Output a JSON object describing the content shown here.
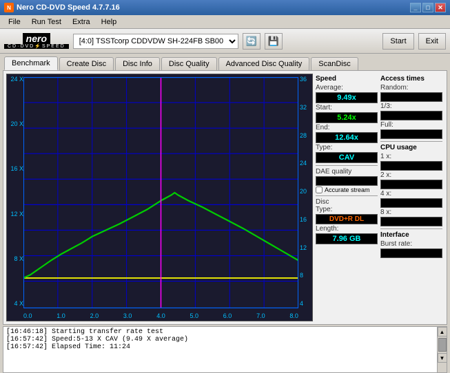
{
  "window": {
    "title": "Nero CD-DVD Speed 4.7.7.16"
  },
  "menu": {
    "items": [
      "File",
      "Run Test",
      "Extra",
      "Help"
    ]
  },
  "toolbar": {
    "drive_value": "[4:0]  TSSTcorp CDDVDW SH-224FB SB00",
    "start_label": "Start",
    "exit_label": "Exit"
  },
  "tabs": [
    {
      "label": "Benchmark",
      "active": true
    },
    {
      "label": "Create Disc",
      "active": false
    },
    {
      "label": "Disc Info",
      "active": false
    },
    {
      "label": "Disc Quality",
      "active": false
    },
    {
      "label": "Advanced Disc Quality",
      "active": false
    },
    {
      "label": "ScanDisc",
      "active": false
    }
  ],
  "speed_panel": {
    "header": "Speed",
    "average_label": "Average:",
    "average_value": "9.49x",
    "start_label": "Start:",
    "start_value": "5.24x",
    "end_label": "End:",
    "end_value": "12.64x",
    "type_label": "Type:",
    "type_value": "CAV"
  },
  "dae_panel": {
    "header": "DAE quality",
    "value": "",
    "accurate_stream_label": "Accurate stream"
  },
  "disc_panel": {
    "header": "Disc",
    "type_label": "Type:",
    "type_value": "DVD+R DL",
    "length_label": "Length:",
    "length_value": "7.96 GB"
  },
  "access_panel": {
    "header": "Access times",
    "random_label": "Random:",
    "random_value": "",
    "onethird_label": "1/3:",
    "onethird_value": "",
    "full_label": "Full:",
    "full_value": ""
  },
  "cpu_panel": {
    "header": "CPU usage",
    "one_label": "1 x:",
    "one_value": "",
    "two_label": "2 x:",
    "two_value": "",
    "four_label": "4 x:",
    "four_value": "",
    "eight_label": "8 x:",
    "eight_value": ""
  },
  "interface_panel": {
    "header": "Interface",
    "burst_label": "Burst rate:",
    "burst_value": ""
  },
  "chart": {
    "left_labels": [
      "24 X",
      "20 X",
      "16 X",
      "12 X",
      "8 X",
      "4 X"
    ],
    "right_labels": [
      "36",
      "32",
      "28",
      "24",
      "20",
      "16",
      "12",
      "8",
      "4"
    ],
    "bottom_labels": [
      "0.0",
      "1.0",
      "2.0",
      "3.0",
      "4.0",
      "5.0",
      "6.0",
      "7.0",
      "8.0"
    ]
  },
  "log": {
    "lines": [
      "[16:46:18] Starting transfer rate test",
      "[16:57:42] Speed:5-13 X CAV (9.49 X average)",
      "[16:57:42] Elapsed Time: 11:24"
    ]
  }
}
